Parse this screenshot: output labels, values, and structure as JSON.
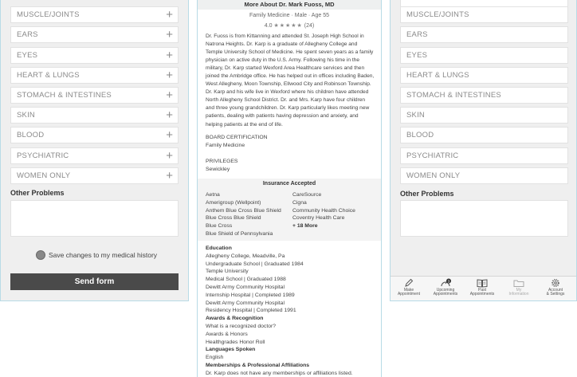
{
  "left": {
    "categories": [
      {
        "label": "MUSCLE/JOINTS"
      },
      {
        "label": "EARS"
      },
      {
        "label": "EYES"
      },
      {
        "label": "HEART & LUNGS"
      },
      {
        "label": "STOMACH & INTESTINES"
      },
      {
        "label": "SKIN"
      },
      {
        "label": "BLOOD"
      },
      {
        "label": "PSYCHIATRIC"
      },
      {
        "label": "WOMEN ONLY"
      }
    ],
    "other_problems_label": "Other Problems",
    "save_label": "Save changes to my medical history",
    "send_label": "Send form"
  },
  "middle": {
    "header": "More About Dr. Mark Fuoss, MD",
    "subline": "Family Medicine  ·  Male  ·  Age 55",
    "rating": "4.0",
    "stars": "★★★★★",
    "reviews": "(24)",
    "bio": "Dr. Fuoss is from Kittanning and attended St. Joseph High School in Natrona Heights. Dr. Karp is a graduate of Allegheny College and Temple University School of Medicine. He spent seven years as a family physician on active duty in the U.S. Army. Following his time in the military, Dr. Karp started Wexford Area Healthcare services and then joined the Ambridge office. He has helped out in offices including Baden, West Allegheny, Moon Township, Ellwood City and Robinson Township. Dr. Karp and his wife live in Wexford where his children have attended North Allegheny School District. Dr. and Mrs. Karp have four children and three young grandchildren. Dr. Karp particularly likes meeting new patients, dealing with patients having depression and anxiety, and helping patients at the end of life.",
    "board_cert_label": "BOARD CERTIFICATION",
    "board_cert_value": "Family Medicine",
    "privileges_label": "PRIVILEGES",
    "privileges_value": "Sewickley",
    "insurance_title": "Insurance Accepted",
    "insurance_col1": [
      "Aetna",
      "Amerigroup (Wellpoint)",
      "Anthem Blue Cross Blue Shield",
      "Blue Cross Blue Shield",
      "Blue Cross",
      "Blue Shield of Pennsylvania"
    ],
    "insurance_col2": [
      "CareSource",
      "Cigna",
      "Community Health Choice",
      "Coventry Health Care"
    ],
    "insurance_more": "+ 18 More",
    "education_head": "Education",
    "education_lines": [
      "Allegheny College, Meadville, Pa",
      "Undergraduate School | Graduated 1984",
      "Temple University",
      "Medical School | Graduated 1988",
      "Dewitt Army Community Hospital",
      "Internship Hospital | Completed 1989",
      "Dewitt Army Community Hospital",
      "Residency Hospital | Completed 1991"
    ],
    "awards_head": "Awards & Recognition",
    "awards_lines": [
      "What is a recognized doctor?",
      "Awards & Honors",
      "Healthgrades Honor Roll"
    ],
    "languages_head": "Languages Spoken",
    "languages_lines": [
      "English"
    ],
    "memberships_head": "Memberships & Professional Affiliations",
    "memberships_lines": [
      "Dr. Karp does not have any memberships or affiliations listed."
    ]
  },
  "right": {
    "categories": [
      {
        "label": "MUSCLE/JOINTS"
      },
      {
        "label": "EARS"
      },
      {
        "label": "EYES"
      },
      {
        "label": "HEART & LUNGS"
      },
      {
        "label": "STOMACH & INTESTINES"
      },
      {
        "label": "SKIN"
      },
      {
        "label": "BLOOD"
      },
      {
        "label": "PSYCHIATRIC"
      },
      {
        "label": "WOMEN ONLY"
      }
    ],
    "other_problems_label": "Other Problems",
    "tabs": [
      {
        "line1": "Make",
        "line2": "Appointment",
        "icon": "pencil-icon"
      },
      {
        "line1": "Upcoming",
        "line2": "Appointments",
        "icon": "clock-icon",
        "badge": "3"
      },
      {
        "line1": "Past",
        "line2": "Appointments",
        "icon": "book-icon"
      },
      {
        "line1": "My",
        "line2": "Information",
        "icon": "folder-icon"
      },
      {
        "line1": "Account",
        "line2": "& Settings",
        "icon": "gear-icon"
      }
    ]
  },
  "colors": {
    "panel_bg": "#efefef",
    "panel_border": "#b8dbe6",
    "button_bg": "#4a4a4a",
    "muted_text": "#8a8a8a"
  }
}
